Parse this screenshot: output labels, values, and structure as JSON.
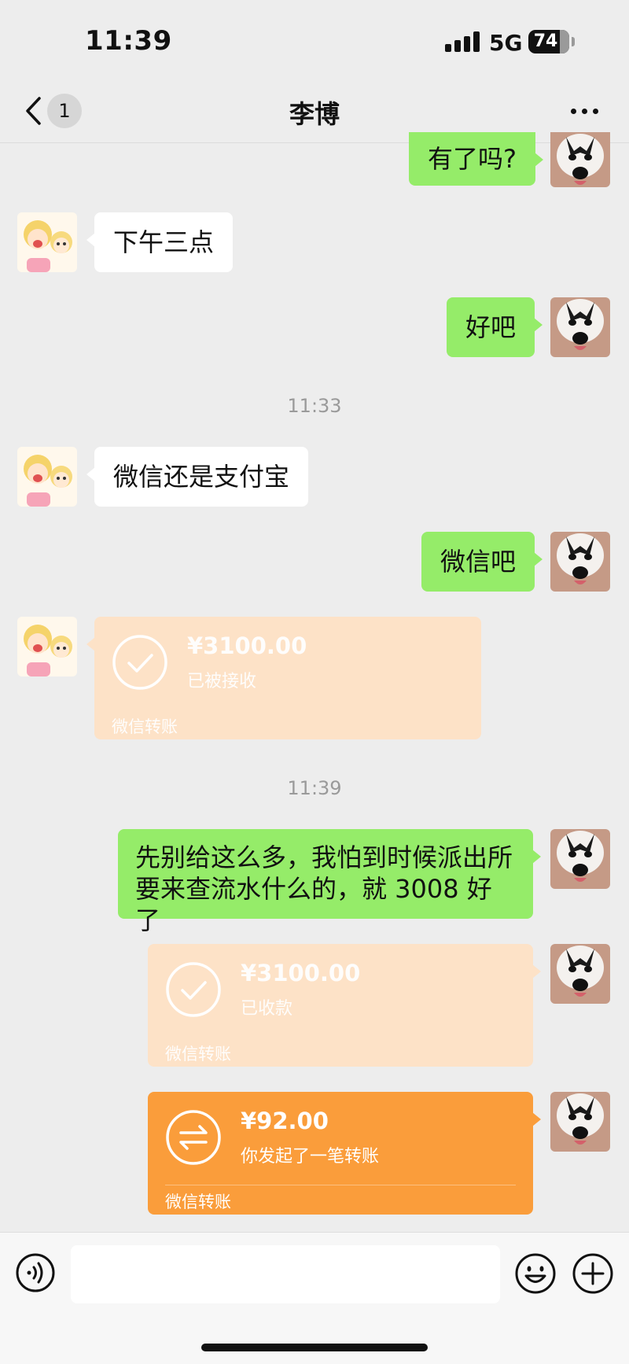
{
  "status_bar": {
    "time": "11:39",
    "network": "5G",
    "battery": "74"
  },
  "nav": {
    "back_count": "1",
    "title": "李博"
  },
  "messages": [
    {
      "text": "有了吗?"
    },
    {
      "text": "下午三点"
    },
    {
      "text": "好吧"
    },
    {
      "text": "微信还是支付宝"
    },
    {
      "text": "微信吧"
    },
    {
      "amount": "¥3100.00",
      "status": "已被接收",
      "footer": "微信转账"
    },
    {
      "text": "先别给这么多，我怕到时候派出所要来查流水什么的，就 3008 好了"
    },
    {
      "amount": "¥3100.00",
      "status": "已收款",
      "footer": "微信转账"
    },
    {
      "amount": "¥92.00",
      "status": "你发起了一笔转账",
      "footer": "微信转账"
    }
  ],
  "timestamps": [
    "11:33",
    "11:39"
  ],
  "input": {
    "placeholder": ""
  },
  "colors": {
    "self_bubble": "#95ec69",
    "other_bubble": "#ffffff",
    "transfer_pending": "#fa9d3b",
    "transfer_done": "#fde2c7",
    "background": "#ededed"
  },
  "icons": {
    "back": "chevron-left-icon",
    "more": "more-dots-icon",
    "voice": "voice-icon",
    "emoji": "emoji-icon",
    "plus": "plus-icon",
    "transfer_done": "check-circle-icon",
    "transfer_pending": "transfer-arrows-icon"
  }
}
